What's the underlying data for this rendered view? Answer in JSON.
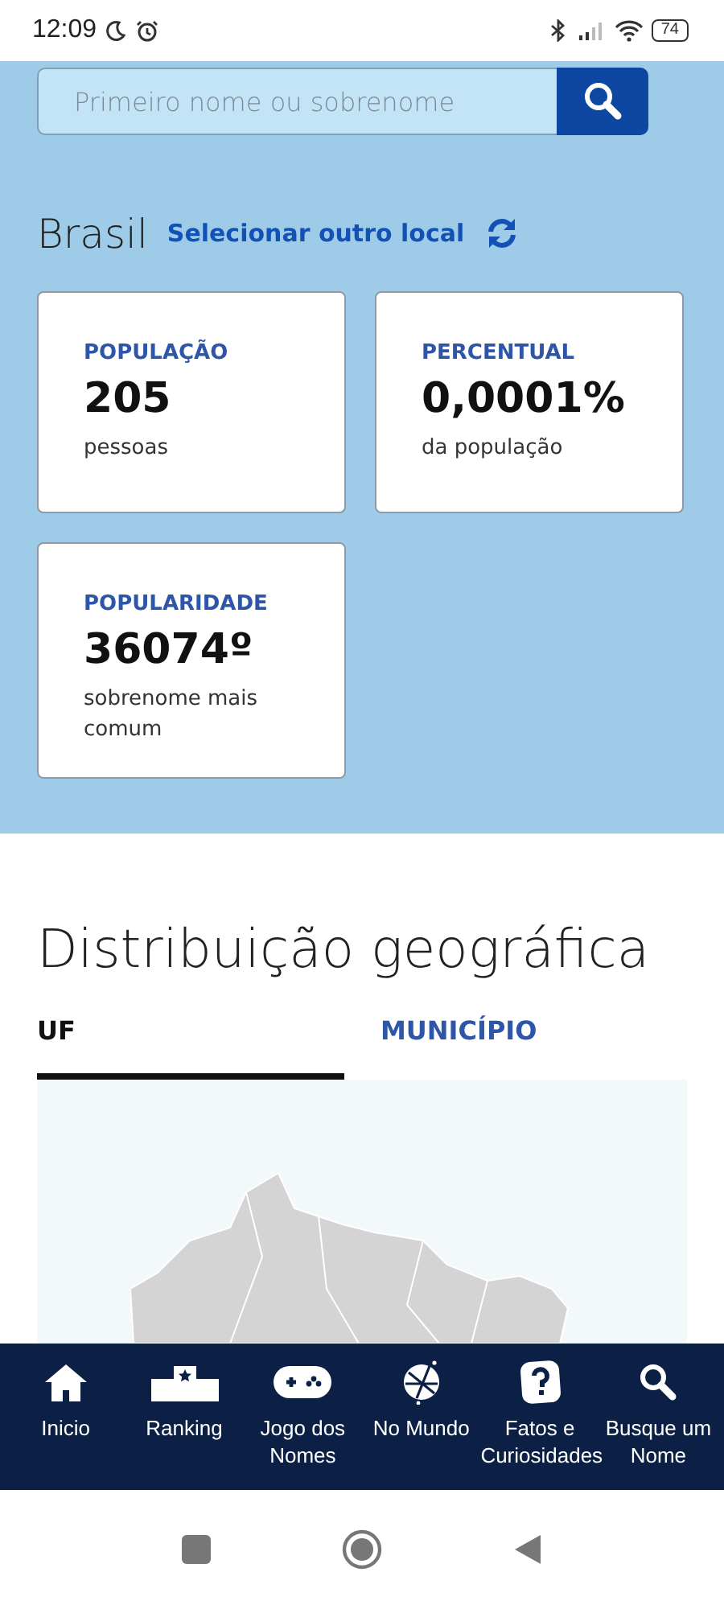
{
  "status_bar": {
    "time": "12:09",
    "battery": "74"
  },
  "search": {
    "placeholder": "Primeiro nome ou sobrenome"
  },
  "location": {
    "name": "Brasil",
    "action": "Selecionar outro local"
  },
  "stats": [
    {
      "label": "POPULAÇÃO",
      "value": "205",
      "caption": "pessoas"
    },
    {
      "label": "PERCENTUAL",
      "value": "0,0001%",
      "caption": "da população"
    },
    {
      "label": "POPULARIDADE",
      "value": "36074º",
      "caption": "sobrenome mais comum"
    }
  ],
  "section_title": "Distribuição geográfica",
  "tabs": [
    {
      "label": "UF",
      "selected": true
    },
    {
      "label": "MUNICÍPIO",
      "selected": false
    }
  ],
  "bottom_nav": [
    {
      "kind": "home",
      "label": "Inicio"
    },
    {
      "kind": "ranking",
      "label": "Ranking"
    },
    {
      "kind": "game",
      "label": "Jogo dos Nomes"
    },
    {
      "kind": "globe",
      "label": "No Mundo"
    },
    {
      "kind": "facts",
      "label": "Fatos e Curiosidades"
    },
    {
      "kind": "search",
      "label": "Busque um Nome"
    }
  ]
}
